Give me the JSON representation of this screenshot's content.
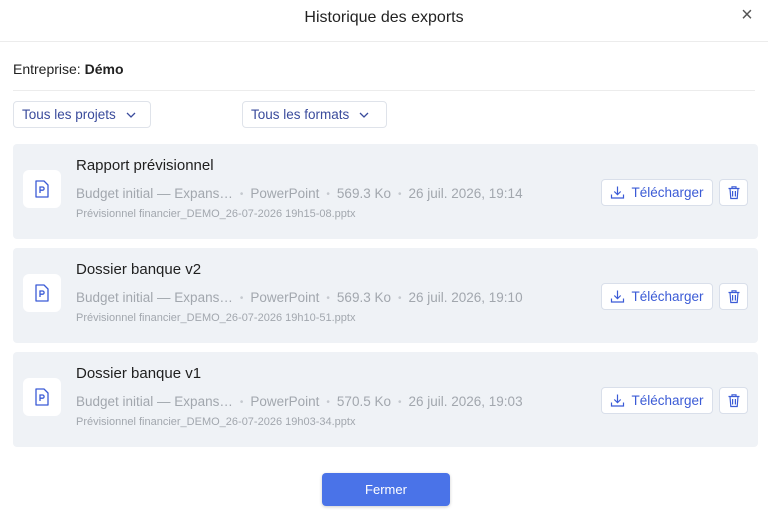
{
  "dialog": {
    "title": "Historique des exports",
    "close_icon": "×"
  },
  "company": {
    "label": "Entreprise:",
    "value": "Démo"
  },
  "filters": {
    "projects_label": "Tous les projets",
    "formats_label": "Tous les formats"
  },
  "exports": [
    {
      "title": "Rapport prévisionnel",
      "project": "Budget initial — Expans…",
      "format": "PowerPoint",
      "size": "569.3 Ko",
      "date": "26 juil. 2026, 19:14",
      "filename": "Prévisionnel financier_DEMO_26-07-2026 19h15-08.pptx",
      "download_label": "Télécharger"
    },
    {
      "title": "Dossier banque v2",
      "project": "Budget initial — Expans…",
      "format": "PowerPoint",
      "size": "569.3 Ko",
      "date": "26 juil. 2026, 19:10",
      "filename": "Prévisionnel financier_DEMO_26-07-2026 19h10-51.pptx",
      "download_label": "Télécharger"
    },
    {
      "title": "Dossier banque v1",
      "project": "Budget initial — Expans…",
      "format": "PowerPoint",
      "size": "570.5 Ko",
      "date": "26 juil. 2026, 19:03",
      "filename": "Prévisionnel financier_DEMO_26-07-2026 19h03-34.pptx",
      "download_label": "Télécharger"
    }
  ],
  "footer": {
    "close_label": "Fermer"
  },
  "colors": {
    "accent": "#4a73e8",
    "link": "#3b5bd6",
    "card_bg": "#eff2f6"
  },
  "icons": {
    "file": "powerpoint-file-icon",
    "download": "download-icon",
    "delete": "trash-icon",
    "dropdown": "chevron-down-icon",
    "close": "close-icon"
  }
}
